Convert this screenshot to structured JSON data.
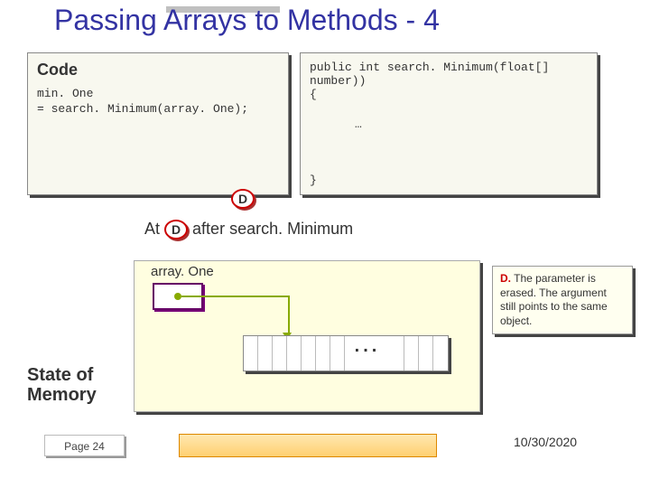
{
  "title": "Passing Arrays to Methods - 4",
  "code_panel": {
    "heading": "Code",
    "line1": "min. One",
    "line2": "= search. Minimum(array. One);",
    "badge": "D"
  },
  "method_panel": {
    "line1": "public int search. Minimum(float[]",
    "line2": "number))",
    "line3": "{",
    "line4": "…",
    "line5": "}"
  },
  "caption": {
    "at": "At",
    "badge": "D",
    "after": "after",
    "func": "search. Minimum"
  },
  "memory": {
    "array_label": "array. One",
    "ellipsis": "..."
  },
  "note": {
    "badge": "D.",
    "text": " The parameter is erased. The argument still points to the same object."
  },
  "state_label_1": "State of",
  "state_label_2": "Memory",
  "page": "Page 24",
  "date": "10/30/2020"
}
